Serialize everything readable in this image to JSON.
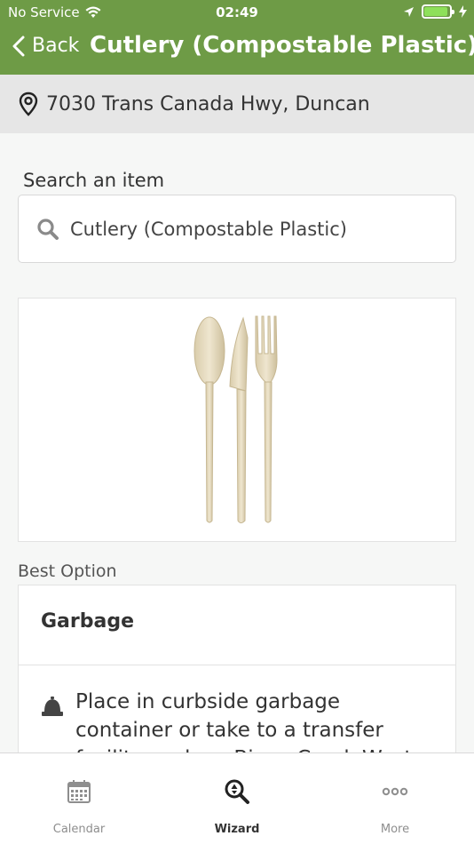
{
  "status_bar": {
    "carrier": "No Service",
    "time": "02:49"
  },
  "nav": {
    "back_label": "Back",
    "title": "Cutlery (Compostable Plastic)"
  },
  "location": {
    "address": "7030 Trans Canada Hwy, Duncan"
  },
  "search": {
    "label": "Search an item",
    "value": "Cutlery (Compostable Plastic)"
  },
  "best_option": {
    "section_label": "Best Option",
    "title": "Garbage",
    "description": "Place in curbside garbage container or take to a transfer facility such as Bings Creek Waste Management"
  },
  "tabbar": {
    "tabs": [
      {
        "label": "Calendar",
        "icon": "calendar-icon"
      },
      {
        "label": "Wizard",
        "icon": "wizard-search-icon",
        "active": true
      },
      {
        "label": "More",
        "icon": "more-icon"
      }
    ]
  },
  "colors": {
    "brand_green": "#6e9b46",
    "battery_green": "#8ee05a"
  }
}
